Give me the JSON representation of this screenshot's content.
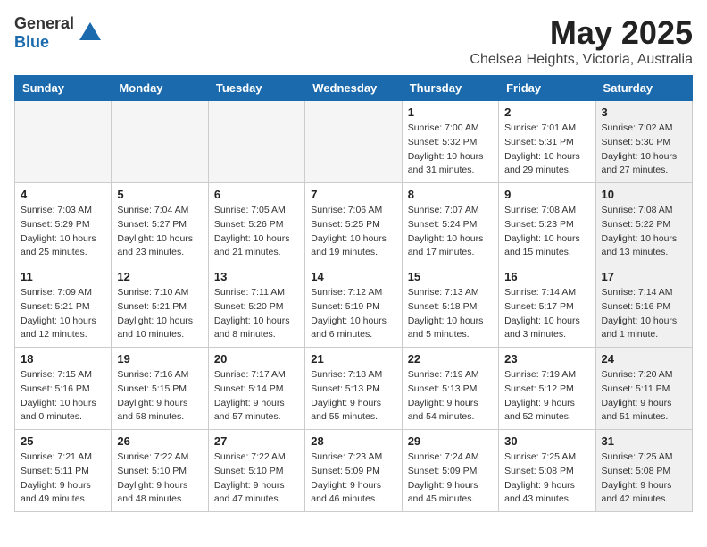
{
  "header": {
    "logo_general": "General",
    "logo_blue": "Blue",
    "month": "May 2025",
    "location": "Chelsea Heights, Victoria, Australia"
  },
  "days_of_week": [
    "Sunday",
    "Monday",
    "Tuesday",
    "Wednesday",
    "Thursday",
    "Friday",
    "Saturday"
  ],
  "weeks": [
    [
      {
        "day": "",
        "info": "",
        "empty": true
      },
      {
        "day": "",
        "info": "",
        "empty": true
      },
      {
        "day": "",
        "info": "",
        "empty": true
      },
      {
        "day": "",
        "info": "",
        "empty": true
      },
      {
        "day": "1",
        "info": "Sunrise: 7:00 AM\nSunset: 5:32 PM\nDaylight: 10 hours\nand 31 minutes.",
        "empty": false
      },
      {
        "day": "2",
        "info": "Sunrise: 7:01 AM\nSunset: 5:31 PM\nDaylight: 10 hours\nand 29 minutes.",
        "empty": false
      },
      {
        "day": "3",
        "info": "Sunrise: 7:02 AM\nSunset: 5:30 PM\nDaylight: 10 hours\nand 27 minutes.",
        "empty": false,
        "shaded": true
      }
    ],
    [
      {
        "day": "4",
        "info": "Sunrise: 7:03 AM\nSunset: 5:29 PM\nDaylight: 10 hours\nand 25 minutes.",
        "empty": false
      },
      {
        "day": "5",
        "info": "Sunrise: 7:04 AM\nSunset: 5:27 PM\nDaylight: 10 hours\nand 23 minutes.",
        "empty": false
      },
      {
        "day": "6",
        "info": "Sunrise: 7:05 AM\nSunset: 5:26 PM\nDaylight: 10 hours\nand 21 minutes.",
        "empty": false
      },
      {
        "day": "7",
        "info": "Sunrise: 7:06 AM\nSunset: 5:25 PM\nDaylight: 10 hours\nand 19 minutes.",
        "empty": false
      },
      {
        "day": "8",
        "info": "Sunrise: 7:07 AM\nSunset: 5:24 PM\nDaylight: 10 hours\nand 17 minutes.",
        "empty": false
      },
      {
        "day": "9",
        "info": "Sunrise: 7:08 AM\nSunset: 5:23 PM\nDaylight: 10 hours\nand 15 minutes.",
        "empty": false
      },
      {
        "day": "10",
        "info": "Sunrise: 7:08 AM\nSunset: 5:22 PM\nDaylight: 10 hours\nand 13 minutes.",
        "empty": false,
        "shaded": true
      }
    ],
    [
      {
        "day": "11",
        "info": "Sunrise: 7:09 AM\nSunset: 5:21 PM\nDaylight: 10 hours\nand 12 minutes.",
        "empty": false
      },
      {
        "day": "12",
        "info": "Sunrise: 7:10 AM\nSunset: 5:21 PM\nDaylight: 10 hours\nand 10 minutes.",
        "empty": false
      },
      {
        "day": "13",
        "info": "Sunrise: 7:11 AM\nSunset: 5:20 PM\nDaylight: 10 hours\nand 8 minutes.",
        "empty": false
      },
      {
        "day": "14",
        "info": "Sunrise: 7:12 AM\nSunset: 5:19 PM\nDaylight: 10 hours\nand 6 minutes.",
        "empty": false
      },
      {
        "day": "15",
        "info": "Sunrise: 7:13 AM\nSunset: 5:18 PM\nDaylight: 10 hours\nand 5 minutes.",
        "empty": false
      },
      {
        "day": "16",
        "info": "Sunrise: 7:14 AM\nSunset: 5:17 PM\nDaylight: 10 hours\nand 3 minutes.",
        "empty": false
      },
      {
        "day": "17",
        "info": "Sunrise: 7:14 AM\nSunset: 5:16 PM\nDaylight: 10 hours\nand 1 minute.",
        "empty": false,
        "shaded": true
      }
    ],
    [
      {
        "day": "18",
        "info": "Sunrise: 7:15 AM\nSunset: 5:16 PM\nDaylight: 10 hours\nand 0 minutes.",
        "empty": false
      },
      {
        "day": "19",
        "info": "Sunrise: 7:16 AM\nSunset: 5:15 PM\nDaylight: 9 hours\nand 58 minutes.",
        "empty": false
      },
      {
        "day": "20",
        "info": "Sunrise: 7:17 AM\nSunset: 5:14 PM\nDaylight: 9 hours\nand 57 minutes.",
        "empty": false
      },
      {
        "day": "21",
        "info": "Sunrise: 7:18 AM\nSunset: 5:13 PM\nDaylight: 9 hours\nand 55 minutes.",
        "empty": false
      },
      {
        "day": "22",
        "info": "Sunrise: 7:19 AM\nSunset: 5:13 PM\nDaylight: 9 hours\nand 54 minutes.",
        "empty": false
      },
      {
        "day": "23",
        "info": "Sunrise: 7:19 AM\nSunset: 5:12 PM\nDaylight: 9 hours\nand 52 minutes.",
        "empty": false
      },
      {
        "day": "24",
        "info": "Sunrise: 7:20 AM\nSunset: 5:11 PM\nDaylight: 9 hours\nand 51 minutes.",
        "empty": false,
        "shaded": true
      }
    ],
    [
      {
        "day": "25",
        "info": "Sunrise: 7:21 AM\nSunset: 5:11 PM\nDaylight: 9 hours\nand 49 minutes.",
        "empty": false
      },
      {
        "day": "26",
        "info": "Sunrise: 7:22 AM\nSunset: 5:10 PM\nDaylight: 9 hours\nand 48 minutes.",
        "empty": false
      },
      {
        "day": "27",
        "info": "Sunrise: 7:22 AM\nSunset: 5:10 PM\nDaylight: 9 hours\nand 47 minutes.",
        "empty": false
      },
      {
        "day": "28",
        "info": "Sunrise: 7:23 AM\nSunset: 5:09 PM\nDaylight: 9 hours\nand 46 minutes.",
        "empty": false
      },
      {
        "day": "29",
        "info": "Sunrise: 7:24 AM\nSunset: 5:09 PM\nDaylight: 9 hours\nand 45 minutes.",
        "empty": false
      },
      {
        "day": "30",
        "info": "Sunrise: 7:25 AM\nSunset: 5:08 PM\nDaylight: 9 hours\nand 43 minutes.",
        "empty": false
      },
      {
        "day": "31",
        "info": "Sunrise: 7:25 AM\nSunset: 5:08 PM\nDaylight: 9 hours\nand 42 minutes.",
        "empty": false,
        "shaded": true
      }
    ]
  ]
}
